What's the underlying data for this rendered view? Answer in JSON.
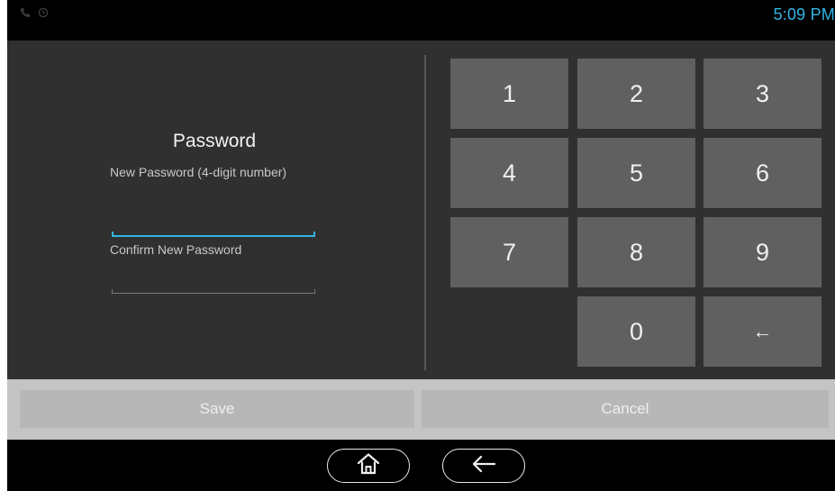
{
  "status_bar": {
    "time": "5:09 PM",
    "icons": [
      "phone-icon",
      "clock-icon"
    ],
    "time_color": "#33b5e5"
  },
  "form": {
    "title": "Password",
    "new_password_label": "New Password (4-digit number)",
    "confirm_password_label": "Confirm New Password",
    "new_password_value": "",
    "confirm_password_value": ""
  },
  "keypad": {
    "keys": [
      "1",
      "2",
      "3",
      "4",
      "5",
      "6",
      "7",
      "8",
      "9",
      "0",
      "←"
    ]
  },
  "actions": {
    "save_label": "Save",
    "cancel_label": "Cancel"
  },
  "nav": {
    "icons": [
      "home-icon",
      "back-arrow-icon"
    ]
  },
  "colors": {
    "accent": "#33b5e5",
    "key_background": "#606060",
    "panel_background": "#303030"
  }
}
